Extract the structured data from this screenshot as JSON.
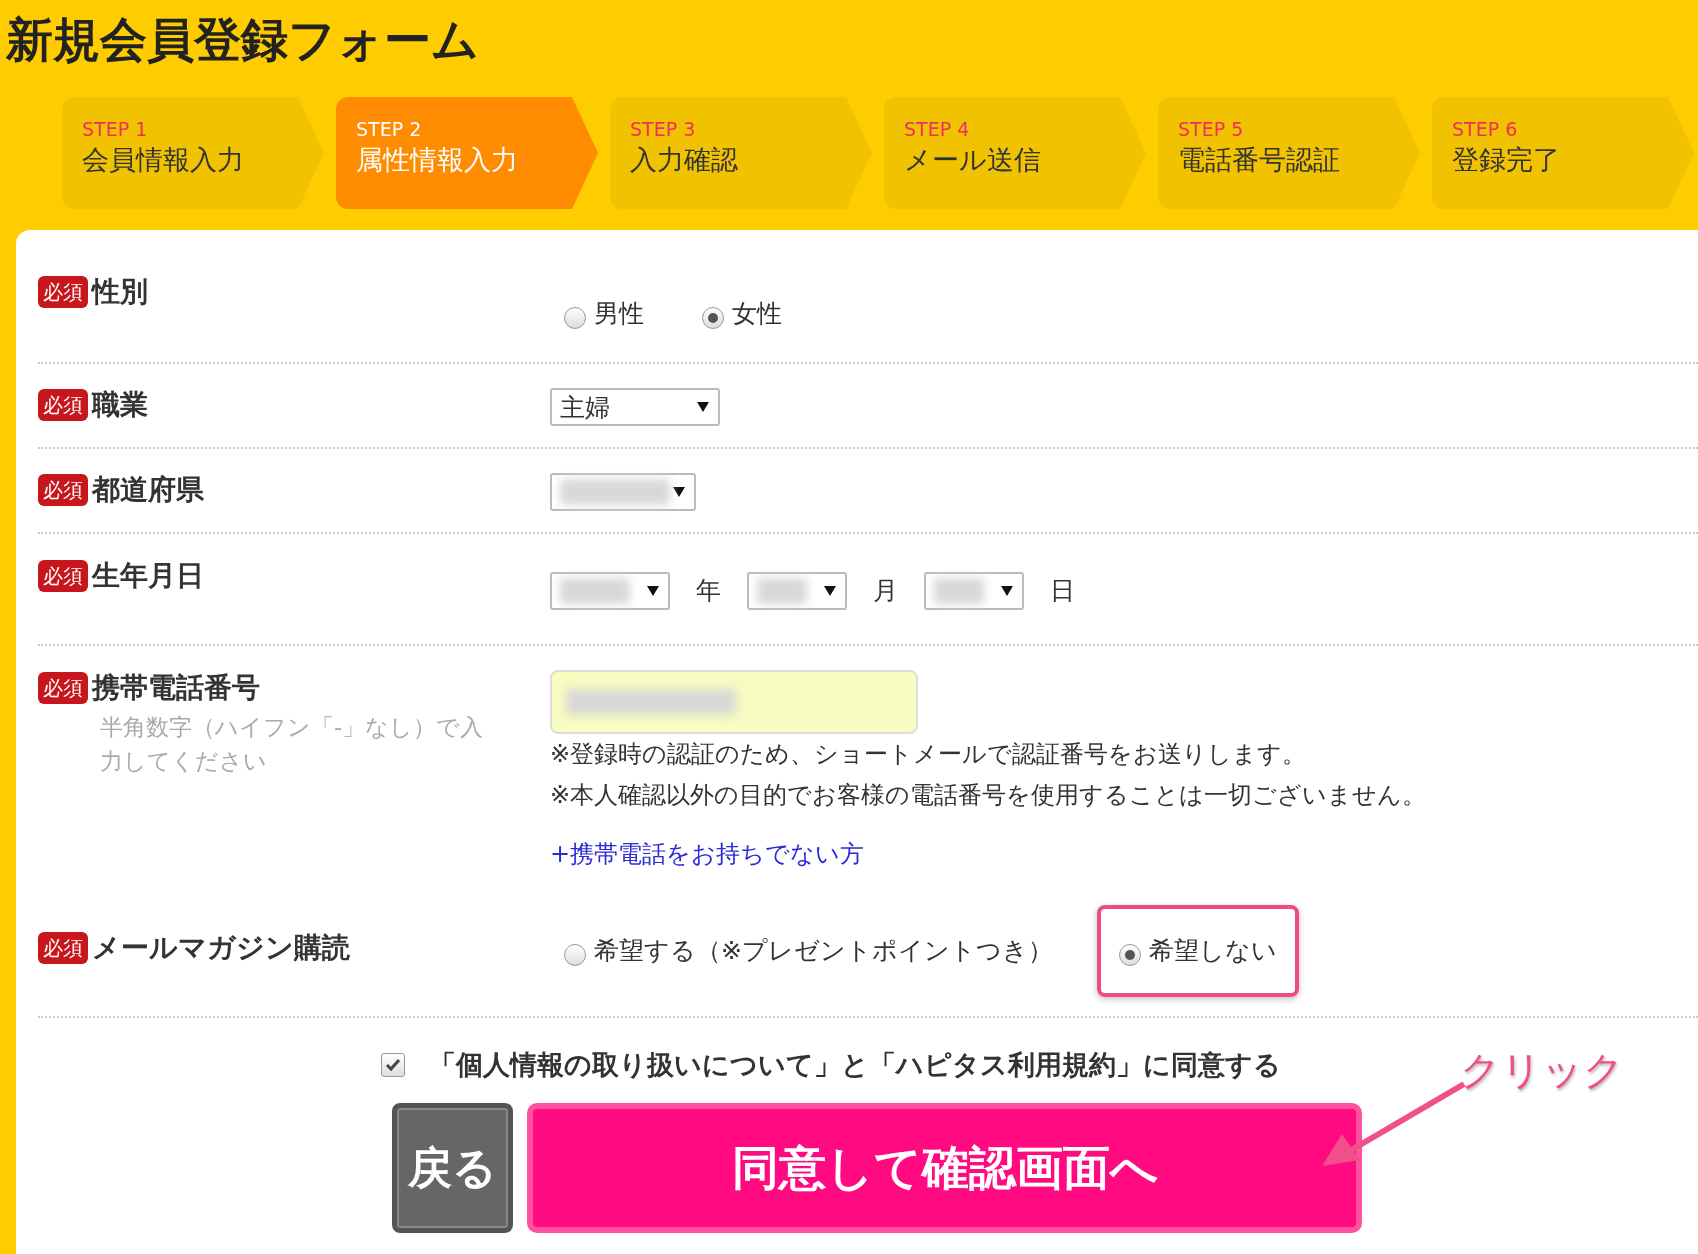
{
  "title": "新規会員登録フォーム",
  "steps": [
    {
      "step": "STEP 1",
      "label": "会員情報入力",
      "selected": false
    },
    {
      "step": "STEP 2",
      "label": "属性情報入力",
      "selected": true
    },
    {
      "step": "STEP 3",
      "label": "入力確認",
      "selected": false
    },
    {
      "step": "STEP 4",
      "label": "メール送信",
      "selected": false
    },
    {
      "step": "STEP 5",
      "label": "電話番号認証",
      "selected": false
    },
    {
      "step": "STEP 6",
      "label": "登録完了",
      "selected": false
    }
  ],
  "fields": [
    {
      "kind": "radio",
      "badge": "必須",
      "label": "性別",
      "options": [
        {
          "label": "男性",
          "selected": false,
          "highlighted": false
        },
        {
          "label": "女性",
          "selected": true,
          "highlighted": false
        }
      ]
    },
    {
      "kind": "select",
      "badge": "必須",
      "label": "職業",
      "selects": [
        {
          "value": "主婦",
          "blurred": false
        }
      ]
    },
    {
      "kind": "select",
      "badge": "必須",
      "label": "都道府県",
      "selects": [
        {
          "blurred": true
        }
      ]
    },
    {
      "kind": "date",
      "badge": "必須",
      "label": "生年月日",
      "selects": [
        {
          "blurred": true,
          "unit": "年"
        },
        {
          "blurred": true,
          "unit": "月"
        },
        {
          "blurred": true,
          "unit": "日"
        }
      ]
    },
    {
      "kind": "phone",
      "badge": "必須",
      "label": "携帯電話番号",
      "hint": "半角数字（ハイフン「-」なし）で入力してください",
      "blurred": true,
      "notes": [
        "※登録時の認証のため、ショートメールで認証番号をお送りします。",
        "※本人確認以外の目的でお客様の電話番号を使用することは一切ございません。"
      ],
      "link": "+携帯電話をお持ちでない方"
    },
    {
      "kind": "radio",
      "badge": "必須",
      "label": "メールマガジン購読",
      "options": [
        {
          "label": "希望する（※プレゼントポイントつき）",
          "selected": false,
          "highlighted": false
        },
        {
          "label": "希望しない",
          "selected": true,
          "highlighted": true
        }
      ]
    }
  ],
  "agreement": {
    "checked": true,
    "text": "「個人情報の取り扱いについて」と「ハピタス利用規約」に同意する"
  },
  "buttons": {
    "back": "戻る",
    "submit": "同意して確認画面へ"
  },
  "annotation": {
    "text": "クリック"
  }
}
